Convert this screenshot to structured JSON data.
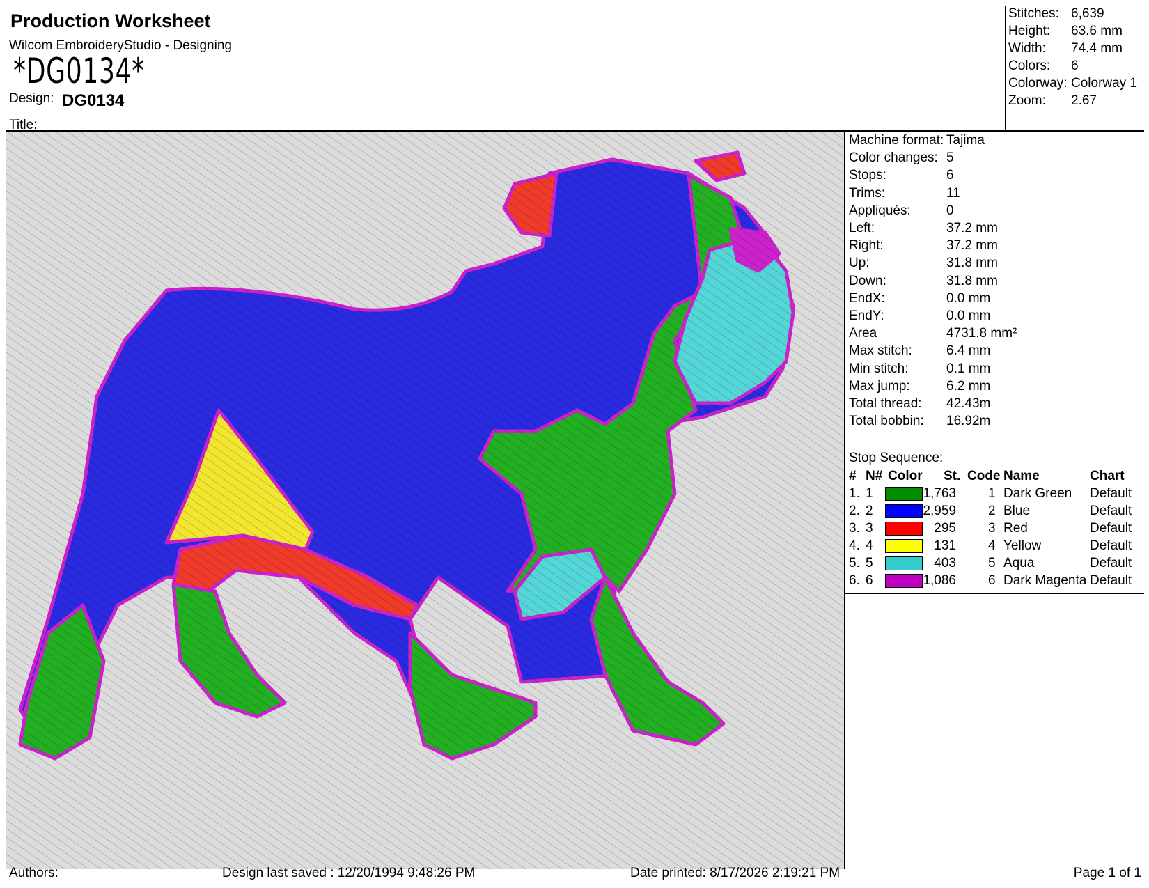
{
  "header": {
    "title": "Production Worksheet",
    "app_name": "Wilcom EmbroideryStudio - Designing",
    "design_code": "*DG0134*",
    "design_label": "Design:",
    "design_value": "DG0134",
    "title_label": "Title:"
  },
  "summary": [
    {
      "label": "Stitches:",
      "value": "6,639"
    },
    {
      "label": "Height:",
      "value": "63.6 mm"
    },
    {
      "label": "Width:",
      "value": "74.4 mm"
    },
    {
      "label": "Colors:",
      "value": "6"
    },
    {
      "label": "Colorway:",
      "value": "Colorway 1"
    },
    {
      "label": "Zoom:",
      "value": "2.67"
    }
  ],
  "stats": [
    {
      "label": "Machine format:",
      "value": "Tajima"
    },
    {
      "label": "Color changes:",
      "value": "5"
    },
    {
      "label": "Stops:",
      "value": "6"
    },
    {
      "label": "Trims:",
      "value": "11"
    },
    {
      "label": "Appliqués:",
      "value": "0"
    },
    {
      "label": "Left:",
      "value": "37.2 mm"
    },
    {
      "label": "Right:",
      "value": "37.2 mm"
    },
    {
      "label": "Up:",
      "value": "31.8 mm"
    },
    {
      "label": "Down:",
      "value": "31.8 mm"
    },
    {
      "label": "EndX:",
      "value": "0.0 mm"
    },
    {
      "label": "EndY:",
      "value": "0.0 mm"
    },
    {
      "label": "Area",
      "value": "4731.8 mm²"
    },
    {
      "label": "Max stitch:",
      "value": "6.4 mm"
    },
    {
      "label": "Min stitch:",
      "value": "0.1 mm"
    },
    {
      "label": "Max jump:",
      "value": "6.2 mm"
    },
    {
      "label": "Total thread:",
      "value": "42.43m"
    },
    {
      "label": "Total bobbin:",
      "value": "16.92m"
    }
  ],
  "stop_sequence": {
    "title": "Stop Sequence:",
    "headers": [
      "#",
      "N#",
      "Color",
      "St.",
      "Code",
      "Name",
      "Chart"
    ],
    "rows": [
      {
        "idx": "1.",
        "n": "1",
        "color": "#008c00",
        "st": "1,763",
        "code": "1",
        "name": "Dark Green",
        "chart": "Default"
      },
      {
        "idx": "2.",
        "n": "2",
        "color": "#0000ff",
        "st": "2,959",
        "code": "2",
        "name": "Blue",
        "chart": "Default"
      },
      {
        "idx": "3.",
        "n": "3",
        "color": "#ff0000",
        "st": "295",
        "code": "3",
        "name": "Red",
        "chart": "Default"
      },
      {
        "idx": "4.",
        "n": "4",
        "color": "#ffff00",
        "st": "131",
        "code": "4",
        "name": "Yellow",
        "chart": "Default"
      },
      {
        "idx": "5.",
        "n": "5",
        "color": "#33cccc",
        "st": "403",
        "code": "5",
        "name": "Aqua",
        "chart": "Default"
      },
      {
        "idx": "6.",
        "n": "6",
        "color": "#c000c0",
        "st": "1,086",
        "code": "6",
        "name": "Dark Magenta",
        "chart": "Default"
      }
    ]
  },
  "footer": {
    "authors": "Authors:",
    "last_saved": "Design last saved : 12/20/1994 9:48:26 PM",
    "printed": "Date printed: 8/17/2026 2:19:21 PM",
    "page": "Page 1 of 1"
  },
  "design_colors": {
    "background": "#dcdcdc",
    "blue": "#2a2ae0",
    "green": "#22b022",
    "red": "#f03a2a",
    "yellow": "#f2e630",
    "aqua": "#55d6d6",
    "magenta": "#cc22cc"
  }
}
